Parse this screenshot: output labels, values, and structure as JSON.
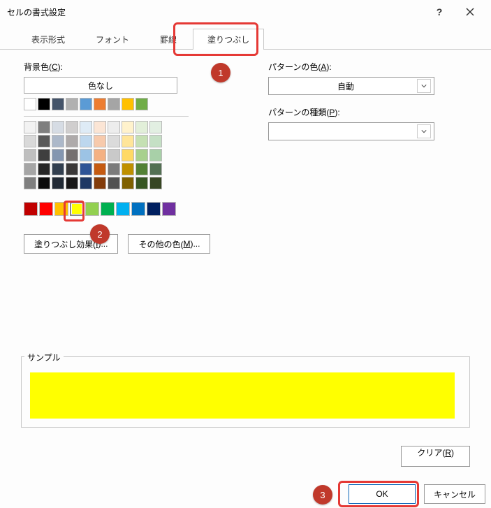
{
  "titlebar": {
    "title": "セルの書式設定"
  },
  "tabs": {
    "display_format": "表示形式",
    "font": "フォント",
    "border": "罫線",
    "fill": "塗りつぶし"
  },
  "labels": {
    "bg_color": "背景色(",
    "bg_color_key": "C",
    "close_paren": "):",
    "pattern_color": "パターンの色(",
    "pattern_color_key": "A",
    "pattern_type": "パターンの種類(",
    "pattern_type_key": "P",
    "sample": "サンプル"
  },
  "buttons": {
    "no_color": "色なし",
    "fill_effects": "塗りつぶし効果(",
    "fill_effects_key": "I",
    "fill_effects_suffix": ")...",
    "other_colors": "その他の色(",
    "other_colors_key": "M",
    "other_colors_suffix": ")...",
    "clear": "クリア(",
    "clear_key": "R",
    "clear_suffix": ")",
    "ok": "OK",
    "cancel": "キャンセル"
  },
  "dropdowns": {
    "pattern_color_value": "自動",
    "pattern_type_value": ""
  },
  "annotations": {
    "a1": "1",
    "a2": "2",
    "a3": "3"
  },
  "palette": {
    "theme_row": [
      "#ffffff",
      "#000000",
      "#44546a",
      "#b0b0b0",
      "#5b9bd5",
      "#ed7d31",
      "#a5a5a5",
      "#ffc000",
      "#70ad47"
    ],
    "grid": [
      [
        "#f2f2f2",
        "#7f7f7f",
        "#d6dce4",
        "#d0cece",
        "#deebf6",
        "#fbe5d5",
        "#ededed",
        "#fff2cc",
        "#e2efd9",
        "#e2efe2"
      ],
      [
        "#d9d9d9",
        "#595959",
        "#acb8c9",
        "#aeaaaa",
        "#bdd7ee",
        "#f7caac",
        "#dbdbdb",
        "#ffe599",
        "#c5e0b3",
        "#c5e0c5"
      ],
      [
        "#bfbfbf",
        "#3f3f3f",
        "#8496b0",
        "#757070",
        "#9cc3e5",
        "#f4b183",
        "#c9c9c9",
        "#ffd965",
        "#a8d08d",
        "#a8d0a8"
      ],
      [
        "#a5a5a5",
        "#262626",
        "#323f4f",
        "#3a3838",
        "#2f5496",
        "#c55a11",
        "#7b7b7b",
        "#bf9000",
        "#538135",
        "#537053"
      ],
      [
        "#7f7f7f",
        "#0c0c0c",
        "#222a35",
        "#171616",
        "#1f3864",
        "#833c0b",
        "#525252",
        "#7f6000",
        "#375623",
        "#374623"
      ]
    ],
    "standard": [
      "#c00000",
      "#ff0000",
      "#ffc000",
      "#ffff00",
      "#92d050",
      "#00b050",
      "#00b0f0",
      "#0070c0",
      "#002060",
      "#7030a0"
    ],
    "selected_index": 3
  },
  "sample": {
    "color": "#ffff00"
  }
}
